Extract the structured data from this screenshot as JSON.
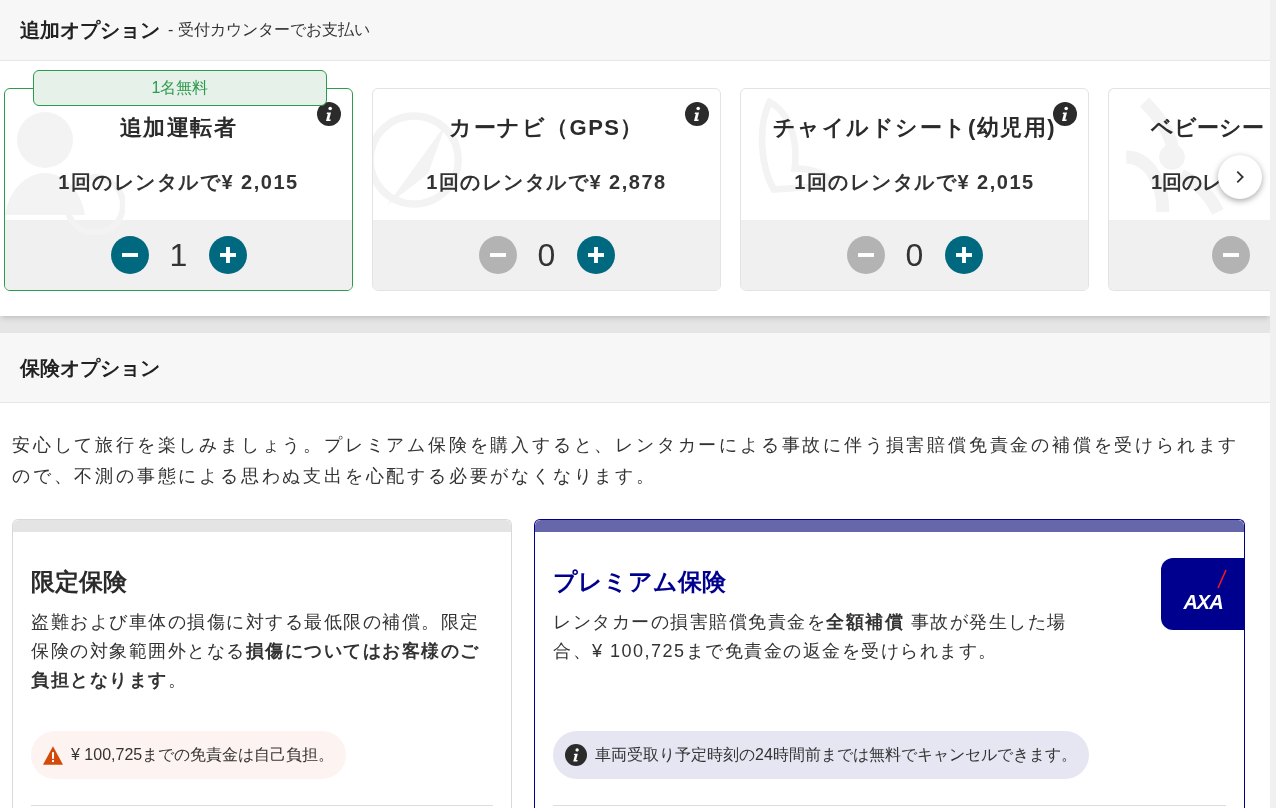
{
  "extras": {
    "title": "追加オプション",
    "subtitle": "- 受付カウンターでお支払い",
    "cards": [
      {
        "kind": "person",
        "title": "追加運転者",
        "price": "1回のレンタルで¥ 2,015",
        "count": "1",
        "selected": true,
        "badge": "1名無料",
        "minus_enabled": true,
        "partial": false
      },
      {
        "kind": "navigation",
        "title": "カーナビ（GPS）",
        "price": "1回のレンタルで¥ 2,878",
        "count": "0",
        "selected": false,
        "minus_enabled": false,
        "partial": false
      },
      {
        "kind": "seat",
        "title": "チャイルドシート(幼児用)",
        "price": "1回のレンタルで¥ 2,015",
        "count": "0",
        "selected": false,
        "minus_enabled": false,
        "partial": false
      },
      {
        "kind": "baby",
        "title": "ベビーシー",
        "price": "1回のレ",
        "selected": false,
        "minus_enabled": false,
        "partial": true
      }
    ]
  },
  "insurance": {
    "title": "保険オプション",
    "intro": "安心して旅行を楽しみましょう。プレミアム保険を購入すると、レンタカーによる事故に伴う損害賠償免責金の補償を受けられますので、不測の事態による思わぬ支出を心配する必要がなくなります。",
    "plans": [
      {
        "kind": "basic",
        "title": "限定保険",
        "description": "盗難および車体の損傷に対する最低限の補償。限定保険の対象範囲外となる**損傷についてはお客様のご負担となります**。",
        "note": "¥ 100,725までの免責金は自己負担。",
        "selected": false
      },
      {
        "kind": "premium",
        "title": "プレミアム保険",
        "description": "レンタカーの損害賠償免責金を**全額補償** 事故が発生した場合、¥ 100,725まで免責金の返金を受けられます。",
        "note": "車両受取り予定時刻の24時間前までは無料でキャンセルできます。",
        "selected": true,
        "logo_text": "AXA"
      }
    ]
  }
}
